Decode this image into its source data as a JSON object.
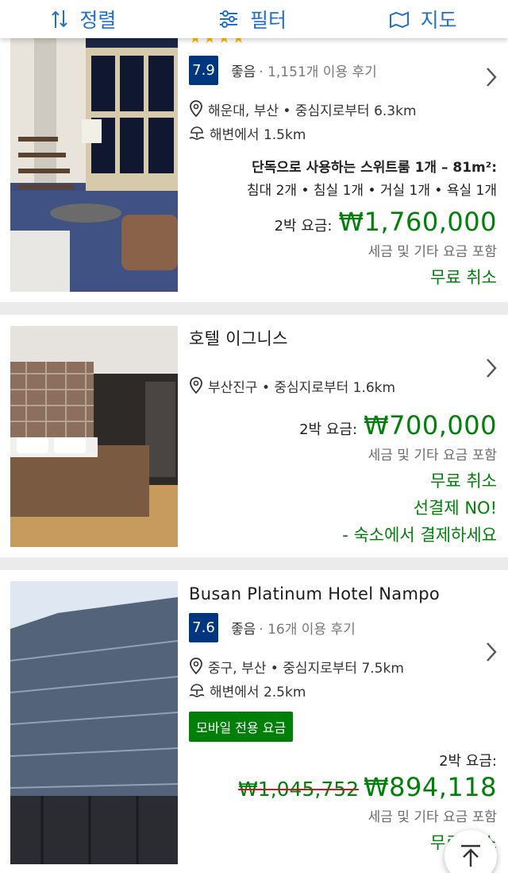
{
  "toolbar": {
    "sort_label": "정렬",
    "filter_label": "필터",
    "map_label": "지도"
  },
  "hotels": [
    {
      "stars": "★★★★",
      "score": "7.9",
      "rating_word": "좋음",
      "reviews": "· 1,151개 이용 후기",
      "location": "해운대, 부산 • 중심지로부터 6.3km",
      "beach": "해변에서 1.5km",
      "room_title": "단독으로 사용하는 스위트룸 1개 – 81m²:",
      "room_detail": "침대 2개 • 침실 1개 • 거실 1개 • 욕실 1개",
      "price_label": "2박 요금:",
      "price": "₩1,760,000",
      "tax_note": "세금 및 기타 요금 포함",
      "free_cancel": "무료 취소"
    },
    {
      "name": "호텔 이그니스",
      "location": "부산진구 • 중심지로부터 1.6km",
      "price_label": "2박 요금:",
      "price": "₩700,000",
      "tax_note": "세금 및 기타 요금 포함",
      "free_cancel": "무료 취소",
      "no_prepay": "선결제 NO!",
      "pay_at_property": "- 숙소에서 결제하세요"
    },
    {
      "name": "Busan Platinum Hotel Nampo",
      "score": "7.6",
      "rating_word": "좋음",
      "reviews": "· 16개 이용 후기",
      "location": "중구, 부산 • 중심지로부터 7.5km",
      "beach": "해변에서 2.5km",
      "mobile_badge": "모바일 전용 요금",
      "price_label": "2박 요금:",
      "old_price": "₩1,045,752",
      "price": "₩894,118",
      "tax_note": "세금 및 기타 요금 포함",
      "free_cancel": "무료 취소"
    }
  ],
  "colors": {
    "accent_blue": "#1e6fd0",
    "score_bg": "#003580",
    "price_green": "#008009",
    "star_yellow": "#febb02"
  }
}
